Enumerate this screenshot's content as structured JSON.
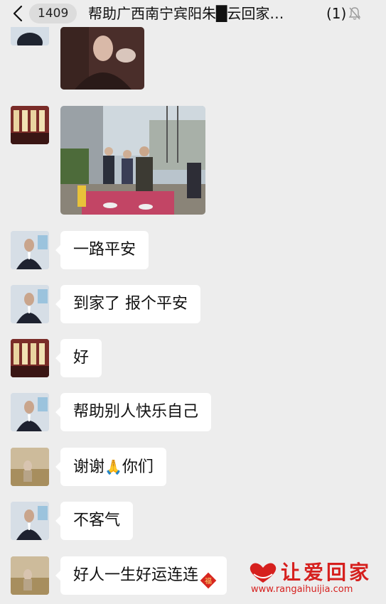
{
  "header": {
    "unread_count": "1409",
    "title": "帮助广西南宁宾阳朱█云回家…",
    "member_count": "(1)",
    "back_icon": "chevron-left-icon",
    "mute_icon": "bell-off-icon"
  },
  "messages": [
    {
      "sender": "volunteer-man",
      "text": "一路平安"
    },
    {
      "sender": "volunteer-man",
      "text": "到家了 报个平安"
    },
    {
      "sender": "wine-avatar",
      "text": "好"
    },
    {
      "sender": "volunteer-man",
      "text": "帮助别人快乐自己"
    },
    {
      "sender": "field-avatar",
      "text_before": "谢谢",
      "emoji": "🙏",
      "text_after": "你们"
    },
    {
      "sender": "volunteer-man",
      "text": "不客气"
    },
    {
      "sender": "field-avatar",
      "text": "好人一生好运连连",
      "sticker": "福"
    }
  ],
  "watermark": {
    "brand": "让爱回家",
    "url": "www.rangaihuijia.com",
    "logo_icon": "heart-hands-icon",
    "color": "#d6201e"
  }
}
